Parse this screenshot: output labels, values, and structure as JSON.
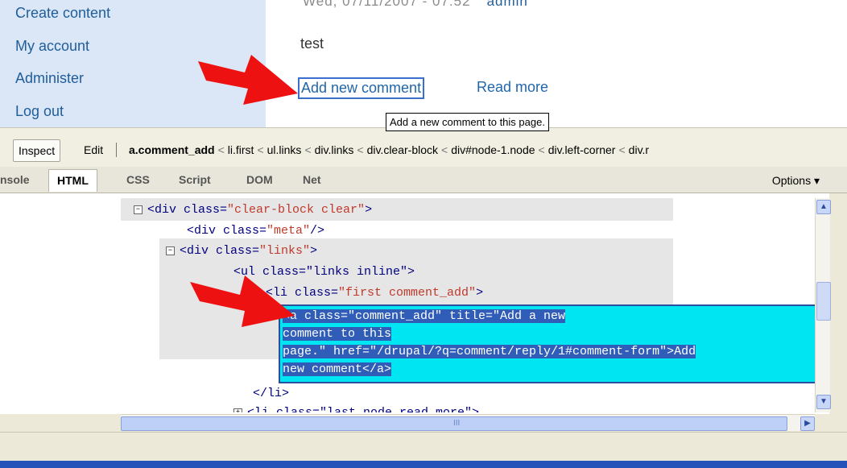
{
  "sidebar": {
    "items": [
      {
        "label": "Create content"
      },
      {
        "label": "My account"
      },
      {
        "label": "Administer"
      },
      {
        "label": "Log out"
      }
    ]
  },
  "node": {
    "meta_date": "Wed, 07/11/2007 - 07:52",
    "meta_author": "admin",
    "body": "test",
    "links": {
      "add_comment": "Add new comment",
      "read_more": "Read more"
    },
    "tooltip": "Add a new comment to this page."
  },
  "firebug": {
    "toolbar": {
      "inspect": "Inspect",
      "edit": "Edit",
      "breadcrumbs": [
        "a.comment_add",
        "li.first",
        "ul.links",
        "div.links",
        "div.clear-block",
        "div#node-1.node",
        "div.left-corner",
        "div.r"
      ]
    },
    "tabs": [
      {
        "label": "nsole",
        "active": false
      },
      {
        "label": "HTML",
        "active": true
      },
      {
        "label": "CSS",
        "active": false
      },
      {
        "label": "Script",
        "active": false
      },
      {
        "label": "DOM",
        "active": false
      },
      {
        "label": "Net",
        "active": false
      }
    ],
    "options_label": "Options ▾",
    "code": {
      "l1_tag": "<div",
      "l1_attr": " class=",
      "l1_val": "\"clear-block clear\"",
      "l1_end": ">",
      "l2_tag": "<div",
      "l2_attr": " class=",
      "l2_val": "\"meta\"",
      "l2_end": "/>",
      "l3_tag": "<div",
      "l3_attr": " class=",
      "l3_val": "\"links\"",
      "l3_end": ">",
      "l4_text": "<ul class=\"links inline\">",
      "l5_tag": "<li",
      "l5_attr": " class=",
      "l5_val": "\"first comment_add\"",
      "l5_end": ">",
      "sel1": "<a class=\"comment_add\" title=\"Add a new",
      "sel2": "comment to this",
      "sel3": "page.\" href=\"/drupal/?q=comment/reply/1#comment-form\">Add",
      "sel4": "new comment</a>",
      "l6_text": "</li>",
      "l7_text": "<li class=\"last node_read_more\">"
    },
    "hscroll_label": "III"
  },
  "colors": {
    "arrow": "#ee1111",
    "sidebar_bg": "#dbe7f6",
    "link": "#2266aa",
    "selection_bg": "#2f5db7",
    "selection_outline_fill": "#00e5f2"
  }
}
